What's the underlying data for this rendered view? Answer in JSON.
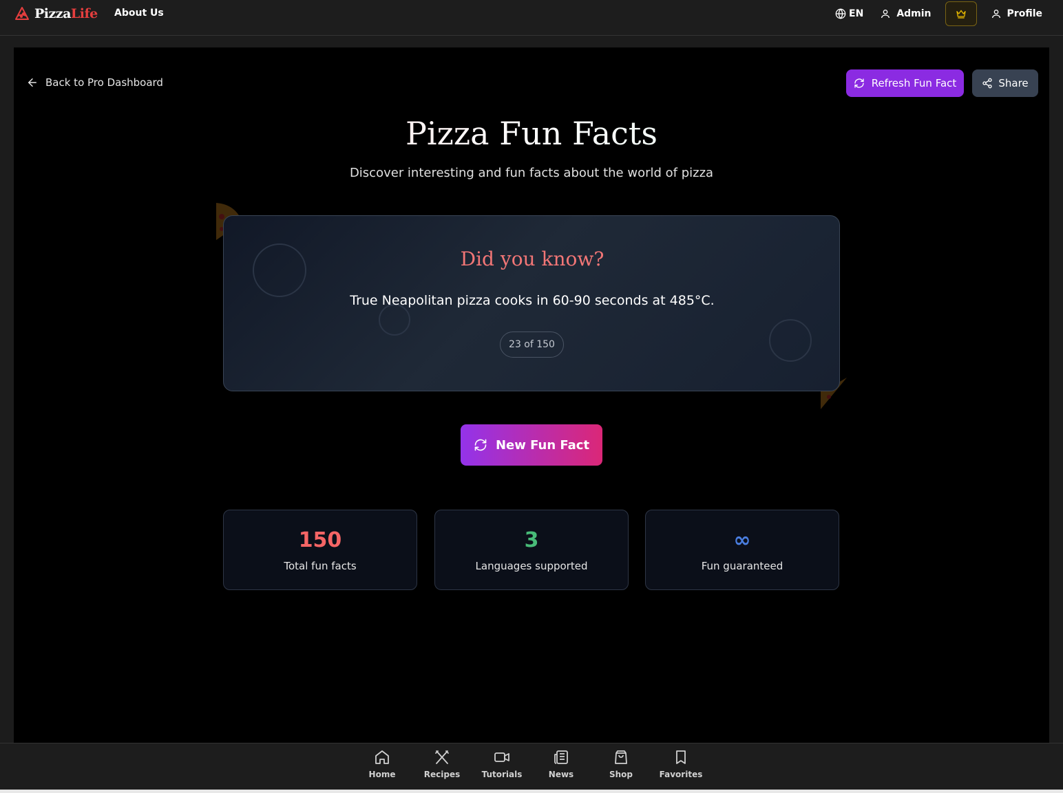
{
  "header": {
    "logo_part1": "Pizza",
    "logo_part2": "Life",
    "about_label": "About Us",
    "language_label": "EN",
    "admin_label": "Admin",
    "profile_label": "Profile"
  },
  "page": {
    "back_label": "Back to Pro Dashboard",
    "refresh_label": "Refresh Fun Fact",
    "share_label": "Share",
    "title": "Pizza Fun Facts",
    "subtitle": "Discover interesting and fun facts about the world of pizza"
  },
  "fact_card": {
    "heading": "Did you know?",
    "fact": "True Neapolitan pizza cooks in 60-90 seconds at 485°C.",
    "counter": "23 of 150"
  },
  "new_fact_label": "New Fun Fact",
  "stats": [
    {
      "value": "150",
      "label": "Total fun facts",
      "color": "#f56565"
    },
    {
      "value": "3",
      "label": "Languages supported",
      "color": "#48bb78"
    },
    {
      "value": "∞",
      "label": "Fun guaranteed",
      "color": "#4a7ee0"
    }
  ],
  "bottom_nav": [
    {
      "label": "Home",
      "icon": "home-icon"
    },
    {
      "label": "Recipes",
      "icon": "utensils-icon"
    },
    {
      "label": "Tutorials",
      "icon": "video-icon"
    },
    {
      "label": "News",
      "icon": "newspaper-icon"
    },
    {
      "label": "Shop",
      "icon": "shopping-bag-icon"
    },
    {
      "label": "Favorites",
      "icon": "bookmark-icon"
    }
  ],
  "colors": {
    "brand_red": "#e53e3e",
    "accent_purple": "#8b2be2",
    "crown_gold": "#e6b800"
  }
}
